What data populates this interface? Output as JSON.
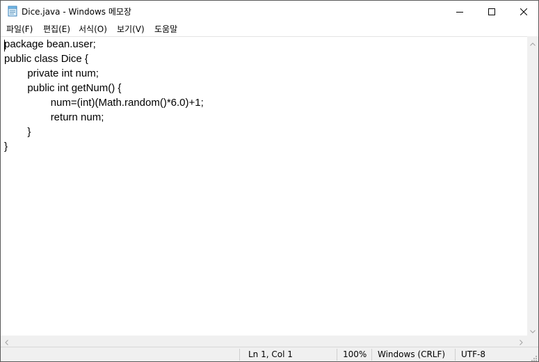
{
  "window": {
    "title": "Dice.java - Windows 메모장",
    "icon": "notepad-icon",
    "controls": {
      "minimize_icon": "minimize-icon",
      "maximize_icon": "maximize-icon",
      "close_icon": "close-icon"
    }
  },
  "menu": {
    "items": [
      {
        "label": "파일(F)"
      },
      {
        "label": "편집(E)"
      },
      {
        "label": "서식(O)"
      },
      {
        "label": "보기(V)"
      },
      {
        "label": "도움말"
      }
    ]
  },
  "editor": {
    "text": "package bean.user;\npublic class Dice {\n\tprivate int num;\n\tpublic int getNum() {\n\t\tnum=(int)(Math.random()*6.0)+1;\n\t\treturn num;\n\t}\n}"
  },
  "statusbar": {
    "position": "Ln 1, Col 1",
    "zoom": "100%",
    "line_ending": "Windows (CRLF)",
    "encoding": "UTF-8"
  },
  "colors": {
    "status_bg": "#f0f0f0",
    "scrollbar_bg": "#f0f0f0",
    "text": "#000000"
  }
}
